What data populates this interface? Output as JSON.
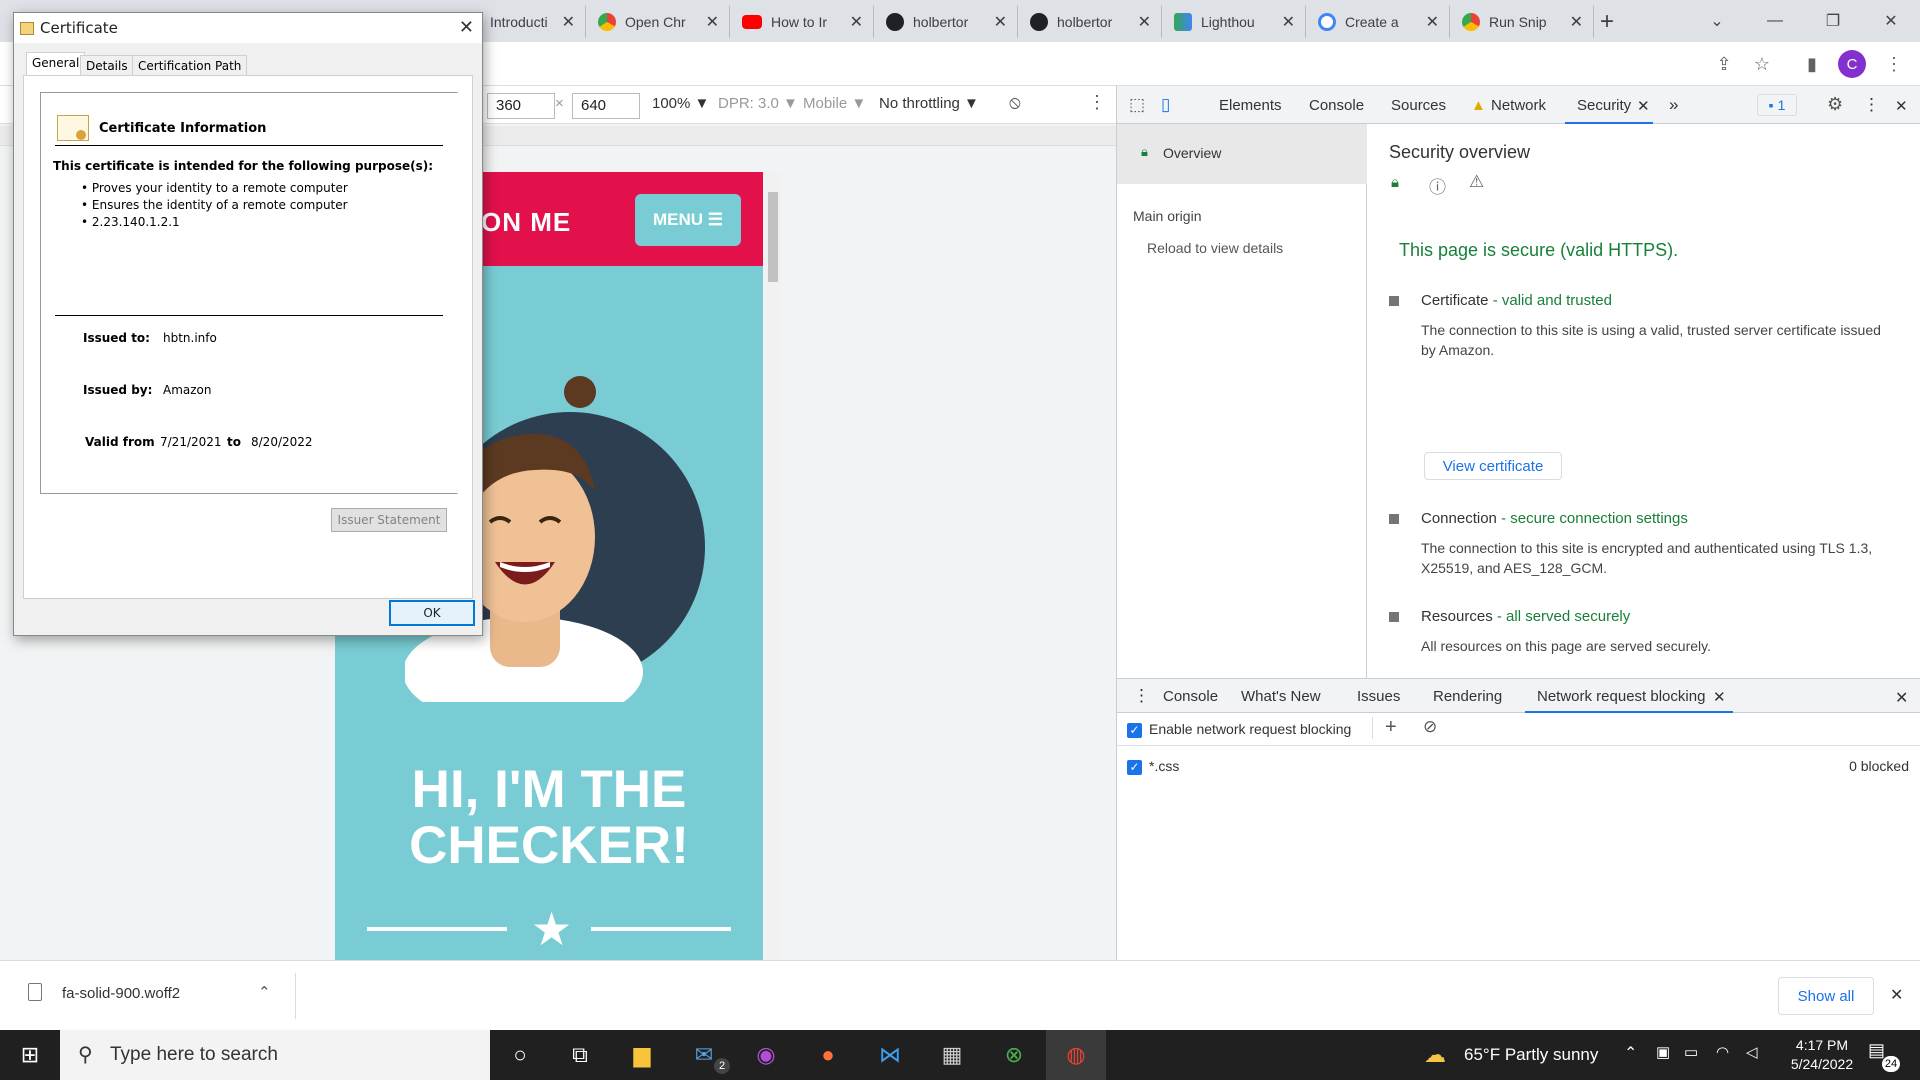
{
  "tabs": [
    {
      "label": "Introducti",
      "icon": "tab-favicon",
      "color": "#5f6368"
    },
    {
      "label": "Open Chr",
      "icon": "chrome-icon",
      "color": "#4285f4"
    },
    {
      "label": "How to Ir",
      "icon": "youtube-icon",
      "color": "#ff0000"
    },
    {
      "label": "holbertor",
      "icon": "github-icon",
      "color": "#202124"
    },
    {
      "label": "holbertor",
      "icon": "github-icon",
      "color": "#202124"
    },
    {
      "label": "Lighthou",
      "icon": "lighthouse-icon",
      "color": "#0f9d58"
    },
    {
      "label": "Create a",
      "icon": "google-icon",
      "color": "#4285f4"
    },
    {
      "label": "Run Snip",
      "icon": "chrome-icon",
      "color": "#4285f4"
    }
  ],
  "toolbar": {
    "avatar_letter": "C"
  },
  "device": {
    "width": "360",
    "height": "640",
    "zoom": "100% ▼",
    "dpr": "DPR: 3.0 ▼",
    "mode": "Mobile ▼",
    "throttling": "No throttling ▼"
  },
  "mobile_page": {
    "title": "ON ME",
    "menu": "MENU ☰",
    "hero_line1": "HI, I'M THE",
    "hero_line2": "CHECKER!"
  },
  "devtools": {
    "tabs": [
      "Elements",
      "Console",
      "Sources",
      "Network",
      "Security"
    ],
    "issues_count": "1",
    "sidebar": {
      "overview": "Overview",
      "main_origin": "Main origin",
      "reload": "Reload to view details"
    },
    "security": {
      "title": "Security overview",
      "status": "This page is secure (valid HTTPS).",
      "certificate_label": "Certificate",
      "certificate_status": "- valid and trusted",
      "certificate_desc": "The connection to this site is using a valid, trusted server certificate issued by Amazon.",
      "view_certificate": "View certificate",
      "connection_label": "Connection",
      "connection_status": "- secure connection settings",
      "connection_desc": "The connection to this site is encrypted and authenticated using TLS 1.3, X25519, and AES_128_GCM.",
      "resources_label": "Resources",
      "resources_status": "- all served securely",
      "resources_desc": "All resources on this page are served securely."
    },
    "drawer": {
      "tabs": [
        "Console",
        "What's New",
        "Issues",
        "Rendering",
        "Network request blocking"
      ],
      "enable_label": "Enable network request blocking",
      "pattern": "*.css",
      "blocked": "0 blocked"
    }
  },
  "downloads": {
    "file": "fa-solid-900.woff2",
    "show_all": "Show all"
  },
  "taskbar": {
    "search_placeholder": "Type here to search",
    "weather": "65°F  Partly sunny",
    "time": "4:17 PM",
    "date": "5/24/2022",
    "notifications": "24",
    "mail_badge": "2"
  },
  "certificate": {
    "window_title": "Certificate",
    "tabs": [
      "General",
      "Details",
      "Certification Path"
    ],
    "info_title": "Certificate Information",
    "purpose_heading": "This certificate is intended for the following purpose(s):",
    "purposes": [
      "• Proves your identity to a remote computer",
      "• Ensures the identity of a remote computer",
      "• 2.23.140.1.2.1"
    ],
    "issued_to_label": "Issued to:",
    "issued_to": "hbtn.info",
    "issued_by_label": "Issued by:",
    "issued_by": "Amazon",
    "valid_from_label": "Valid from",
    "valid_from": "7/21/2021",
    "to_label": "to",
    "valid_to": "8/20/2022",
    "issuer_statement": "Issuer Statement",
    "ok": "OK"
  }
}
